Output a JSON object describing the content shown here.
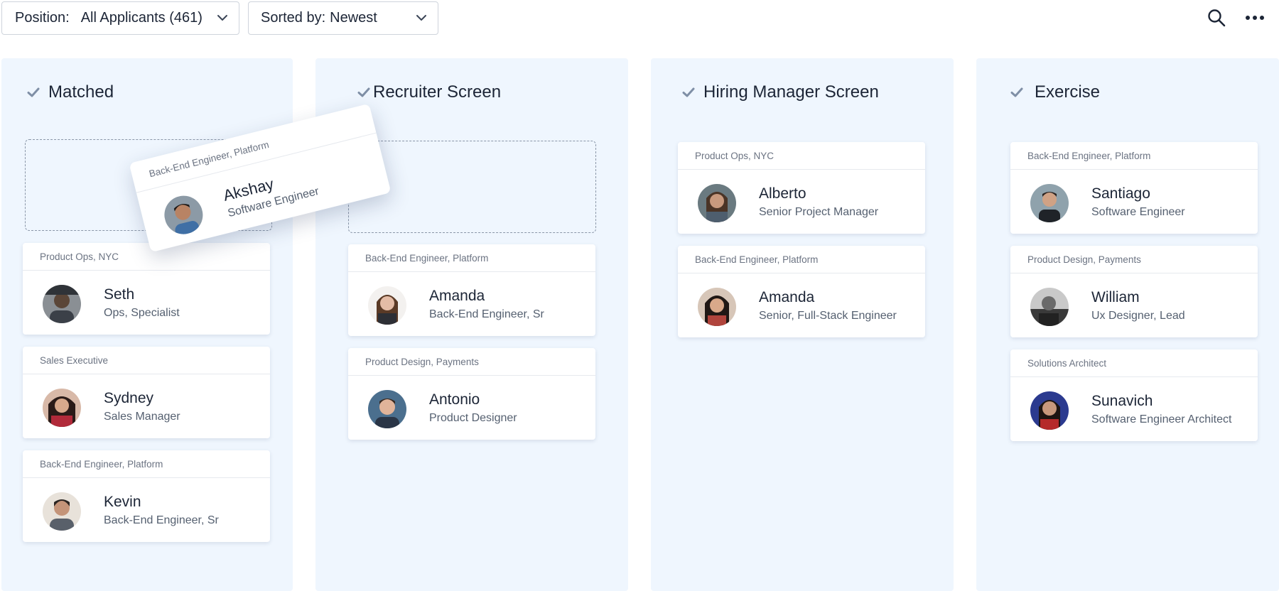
{
  "filters": {
    "position_label": "Position:",
    "position_value": "All Applicants (461)",
    "sort_label": "Sorted by:",
    "sort_value": "Newest"
  },
  "toolbar": {
    "search_icon": "search-icon",
    "more_icon": "more-horizontal-icon"
  },
  "colors": {
    "column_bg": "#eff6fe",
    "check": "#7f8fa6",
    "text": "#1c2536",
    "muted": "#556070"
  },
  "columns": [
    {
      "title": "Matched",
      "cards": [
        {
          "tag": "Product Ops, NYC",
          "name": "Seth",
          "role": "Ops, Specialist"
        },
        {
          "tag": "Sales Executive",
          "name": "Sydney",
          "role": "Sales Manager"
        },
        {
          "tag": "Back-End Engineer, Platform",
          "name": "Kevin",
          "role": "Back-End Engineer, Sr"
        }
      ]
    },
    {
      "title": "Recruiter Screen",
      "cards": [
        {
          "tag": "Back-End Engineer, Platform",
          "name": "Amanda",
          "role": "Back-End Engineer, Sr"
        },
        {
          "tag": "Product Design, Payments",
          "name": "Antonio",
          "role": "Product Designer"
        }
      ]
    },
    {
      "title": "Hiring Manager Screen",
      "cards": [
        {
          "tag": "Product Ops, NYC",
          "name": "Alberto",
          "role": "Senior Project Manager"
        },
        {
          "tag": "Back-End Engineer, Platform",
          "name": "Amanda",
          "role": "Senior, Full-Stack Engineer"
        }
      ]
    },
    {
      "title": "Exercise",
      "cards": [
        {
          "tag": "Back-End Engineer, Platform",
          "name": "Santiago",
          "role": "Software Engineer"
        },
        {
          "tag": "Product Design, Payments",
          "name": "William",
          "role": "Ux Designer, Lead"
        },
        {
          "tag": "Solutions Architect",
          "name": "Sunavich",
          "role": "Software Engineer Architect"
        }
      ]
    }
  ],
  "dragging_card": {
    "tag": "Back-End Engineer, Platform",
    "name": "Akshay",
    "role": "Software Engineer"
  }
}
